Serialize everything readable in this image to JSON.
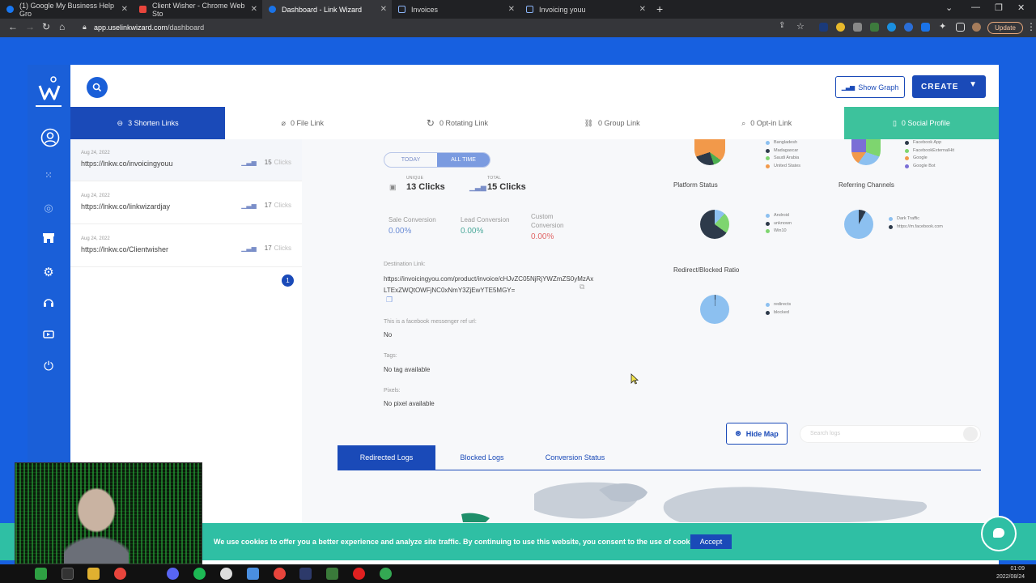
{
  "browser": {
    "tabs": [
      {
        "title": "(1) Google My Business Help Gro",
        "color": "#1877f2"
      },
      {
        "title": "Client Wisher - Chrome Web Sto",
        "color": "#e8453c"
      },
      {
        "title": "Dashboard - Link Wizard",
        "color": "#1a73e8"
      },
      {
        "title": "Invoices",
        "color": "#8ab4f8"
      },
      {
        "title": "Invoicing youu",
        "color": "#8ab4f8"
      }
    ],
    "url_domain": "app.uselinkwizard.com",
    "url_path": "/dashboard",
    "update_label": "Update"
  },
  "header": {
    "show_graph_label": "Show Graph",
    "create_label": "CREATE"
  },
  "link_tabs": [
    {
      "label": "3 Shorten Links"
    },
    {
      "label": "0 File Link"
    },
    {
      "label": "0 Rotating Link"
    },
    {
      "label": "0 Group Link"
    },
    {
      "label": "0 Opt-in Link"
    },
    {
      "label": "0 Social Profile"
    }
  ],
  "links": [
    {
      "date": "Aug 24, 2022",
      "url": "https://lnkw.co/invoicingyouu",
      "clicks": "15",
      "clicks_label": "Clicks"
    },
    {
      "date": "Aug 24, 2022",
      "url": "https://lnkw.co/linkwizardjay",
      "clicks": "17",
      "clicks_label": "Clicks"
    },
    {
      "date": "Aug 24, 2022",
      "url": "https://lnkw.co/Clientwisher",
      "clicks": "17",
      "clicks_label": "Clicks"
    }
  ],
  "pagination": {
    "current": "1"
  },
  "detail": {
    "toggle_today": "TODAY",
    "toggle_all": "ALL TIME",
    "unique_label": "UNIQUE",
    "unique_value": "13 Clicks",
    "total_label": "TOTAL",
    "total_value": "15 Clicks",
    "sale_conv_label": "Sale Conversion",
    "sale_conv_value": "0.00%",
    "lead_conv_label": "Lead Conversion",
    "lead_conv_value": "0.00%",
    "custom_conv_label": "Custom Conversion",
    "custom_conv_value": "0.00%",
    "dest_label": "Destination Link:",
    "dest_value": "https://invoicingyou.com/product/invoice/cHJvZC05NjRjYWZmZS0yMzAxLTExZWQtOWFjNC0xNmY3ZjEwYTE5MGY=",
    "messenger_label": "This is a facebook messenger ref url:",
    "messenger_value": "No",
    "tags_label": "Tags:",
    "tags_value": "No tag available",
    "pixels_label": "Pixels:",
    "pixels_value": "No pixel available"
  },
  "charts": {
    "country_legend": [
      "Bangladesh",
      "Madagascar",
      "Saudi Arabia",
      "United States"
    ],
    "referrer_legend": [
      "Facebook App",
      "FacebookExternalHit",
      "Google",
      "Google Bot"
    ],
    "platform_title": "Platform Status",
    "platform_legend": [
      "Android",
      "unknown",
      "Win10"
    ],
    "channels_title": "Referring Channels",
    "channels_legend": [
      "Dark Traffic",
      "https://m.facebook.com"
    ],
    "ratio_title": "Redirect/Blocked Ratio",
    "ratio_legend": [
      "redirects",
      "blocked"
    ]
  },
  "map_controls": {
    "hide_map_label": "Hide Map",
    "search_placeholder": "Search logs"
  },
  "log_tabs": [
    {
      "label": "Redirected Logs"
    },
    {
      "label": "Blocked Logs"
    },
    {
      "label": "Conversion Status"
    }
  ],
  "cookie": {
    "text": "We use cookies to offer you a better experience and analyze site traffic. By continuing to use this website, you consent to the use of cookies",
    "accept_label": "Accept"
  },
  "clock": {
    "time": "01:09",
    "date": "2022/08/24"
  },
  "colors": {
    "brand_blue": "#1a4ab8",
    "teal": "#3dc29c"
  }
}
